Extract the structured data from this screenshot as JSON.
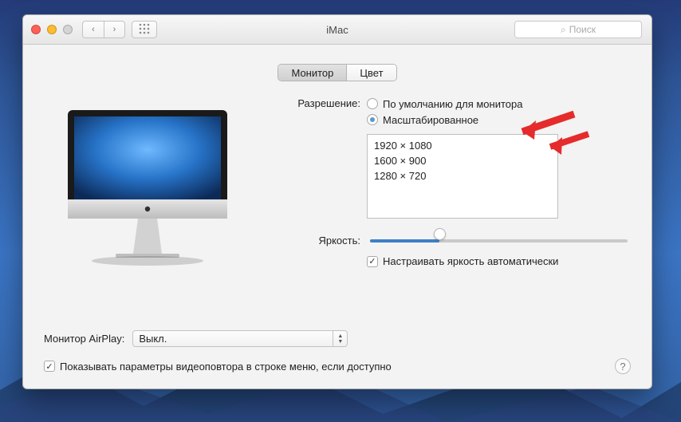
{
  "window": {
    "title": "iMac",
    "search_placeholder": "Поиск"
  },
  "tabs": {
    "monitor": "Монитор",
    "color": "Цвет"
  },
  "resolution": {
    "label": "Разрешение:",
    "default_label": "По умолчанию для монитора",
    "scaled_label": "Масштабированное",
    "options": [
      "1920 × 1080",
      "1600 × 900",
      "1280 × 720"
    ]
  },
  "brightness": {
    "label": "Яркость:",
    "auto_label": "Настраивать яркость автоматически",
    "value_percent": 27
  },
  "airplay": {
    "label": "Монитор AirPlay:",
    "value": "Выкл."
  },
  "bottom": {
    "show_mirror_label": "Показывать параметры видеоповтора в строке меню, если доступно"
  },
  "icons": {
    "search": "⌕",
    "chevron_left": "‹",
    "chevron_right": "›",
    "grid": "⁜",
    "up": "▲",
    "down": "▼",
    "check": "✓",
    "help": "?"
  }
}
